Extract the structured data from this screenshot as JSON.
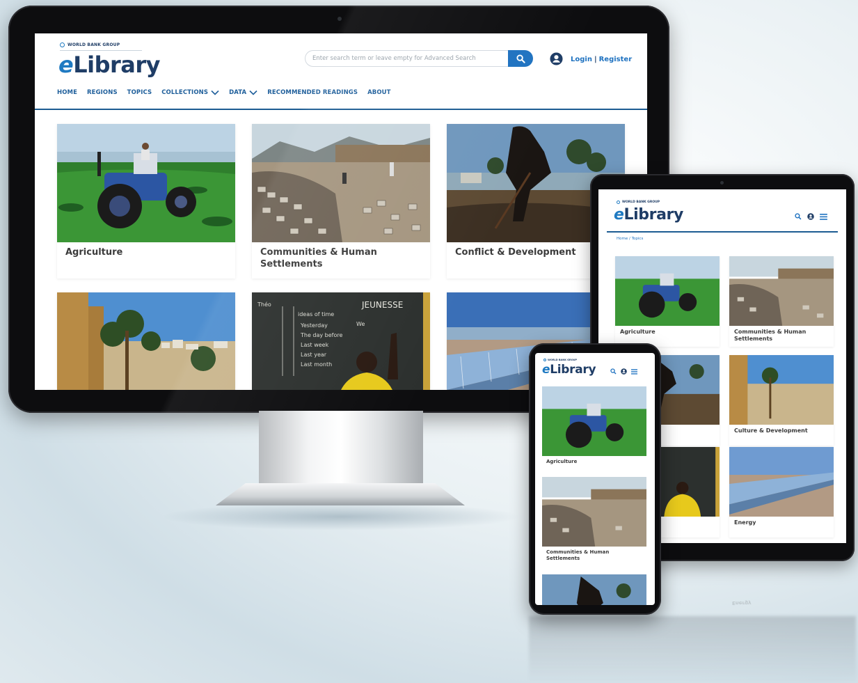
{
  "brand": {
    "group": "WORLD BANK GROUP",
    "logo_e": "e",
    "logo_rest": "Library"
  },
  "search": {
    "placeholder": "Enter search term or leave empty for Advanced Search",
    "button_icon": "search-icon"
  },
  "auth": {
    "login": "Login",
    "separator": "|",
    "register": "Register"
  },
  "nav": {
    "items": [
      {
        "label": "HOME"
      },
      {
        "label": "REGIONS"
      },
      {
        "label": "TOPICS"
      },
      {
        "label": "COLLECTIONS",
        "dropdown": true
      },
      {
        "label": "DATA",
        "dropdown": true
      },
      {
        "label": "RECOMMENDED READINGS"
      },
      {
        "label": "ABOUT"
      }
    ]
  },
  "topics": [
    {
      "title": "Agriculture",
      "image": "tractor-field"
    },
    {
      "title": "Communities & Human Settlements",
      "image": "brick-piles"
    },
    {
      "title": "Conflict & Development",
      "image": "worker-digging"
    },
    {
      "title": "Culture & Development",
      "image": "palm-city"
    },
    {
      "title": "",
      "image": "chalkboard-student"
    },
    {
      "title": "Energy",
      "image": "solar-panels"
    }
  ],
  "tablet": {
    "breadcrumb_home": "Home",
    "breadcrumb_sep": "/",
    "breadcrumb_current": "Topics",
    "partial_title": "elopment"
  },
  "phone": {
    "titles": [
      "Agriculture",
      "Communities & Human",
      "Settlements"
    ]
  },
  "chalkboard": {
    "heading": "JEUNESSE",
    "lines": [
      "ideas of time",
      "Yesterday",
      "The day before",
      "Last week",
      "Last year",
      "Last month",
      "We",
      "Théo"
    ]
  },
  "colors": {
    "brand_navy": "#1f3d66",
    "brand_blue": "#1f72c0",
    "nav_rule": "#1c5c92"
  }
}
